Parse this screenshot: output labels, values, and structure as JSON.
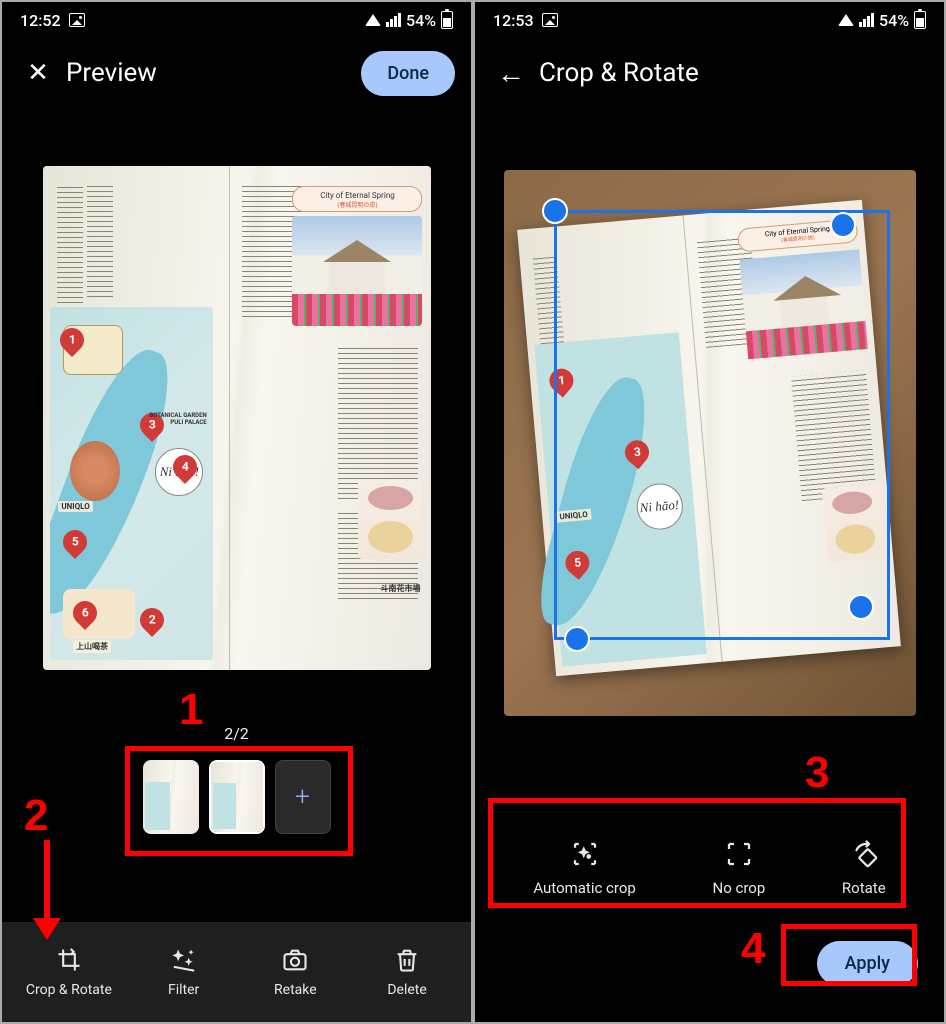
{
  "left": {
    "status": {
      "time": "12:52",
      "battery_pct": "54%"
    },
    "appbar": {
      "title": "Preview",
      "done_label": "Done"
    },
    "page_counter": "2/2",
    "thumbnails": {
      "add_symbol": "+"
    },
    "toolbar": {
      "crop_rotate": "Crop & Rotate",
      "filter": "Filter",
      "retake": "Retake",
      "delete": "Delete"
    }
  },
  "right": {
    "status": {
      "time": "12:53",
      "battery_pct": "54%"
    },
    "appbar": {
      "title": "Crop & Rotate"
    },
    "crop_actions": {
      "auto": "Automatic crop",
      "none": "No crop",
      "rotate": "Rotate"
    },
    "apply_label": "Apply"
  },
  "callouts": {
    "n1": "1",
    "n2": "2",
    "n3": "3",
    "n4": "4"
  },
  "book_sample": {
    "city_heading": "City of Eternal Spring",
    "city_sub": "(春城昆明の旅)",
    "speech": "Ni hăo!",
    "label_botanic": "BOTANICAL GARDEN",
    "label_palace": "PULI PALACE",
    "label_uniqlo": "UNIQLO",
    "label_upmtn": "上山喝茶",
    "label_market": "斗南花市場"
  }
}
